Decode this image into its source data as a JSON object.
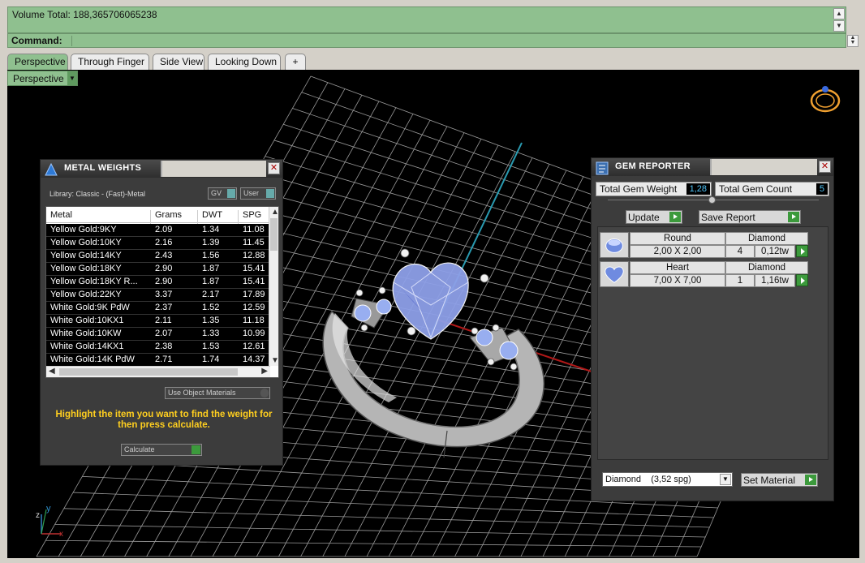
{
  "command": {
    "history_text": "Volume Total: 188,365706065238",
    "prompt_label": "Command:",
    "input_value": ""
  },
  "tabs": [
    {
      "label": "Perspective",
      "active": true
    },
    {
      "label": "Through Finger",
      "active": false
    },
    {
      "label": "Side View",
      "active": false
    },
    {
      "label": "Looking Down",
      "active": false
    },
    {
      "label": "+",
      "active": false
    }
  ],
  "viewport": {
    "selector_label": "Perspective",
    "axis_labels": {
      "x": "x",
      "y": "y",
      "z": "z"
    }
  },
  "metal_weights": {
    "title": "METAL WEIGHTS",
    "library_label": "Library: Classic - (Fast)-Metal",
    "unit_selector": "GV",
    "user_selector": "User",
    "columns": [
      "Metal",
      "Grams",
      "DWT",
      "SPG"
    ],
    "rows": [
      {
        "metal": "Yellow Gold:9KY",
        "grams": "2.09",
        "dwt": "1.34",
        "spg": "11.08"
      },
      {
        "metal": "Yellow Gold:10KY",
        "grams": "2.16",
        "dwt": "1.39",
        "spg": "11.45"
      },
      {
        "metal": "Yellow Gold:14KY",
        "grams": "2.43",
        "dwt": "1.56",
        "spg": "12.88"
      },
      {
        "metal": "Yellow Gold:18KY",
        "grams": "2.90",
        "dwt": "1.87",
        "spg": "15.41"
      },
      {
        "metal": "Yellow Gold:18KY R...",
        "grams": "2.90",
        "dwt": "1.87",
        "spg": "15.41"
      },
      {
        "metal": "Yellow Gold:22KY",
        "grams": "3.37",
        "dwt": "2.17",
        "spg": "17.89"
      },
      {
        "metal": "White Gold:9K PdW",
        "grams": "2.37",
        "dwt": "1.52",
        "spg": "12.59"
      },
      {
        "metal": "White Gold:10KX1",
        "grams": "2.11",
        "dwt": "1.35",
        "spg": "11.18"
      },
      {
        "metal": "White Gold:10KW",
        "grams": "2.07",
        "dwt": "1.33",
        "spg": "10.99"
      },
      {
        "metal": "White Gold:14KX1",
        "grams": "2.38",
        "dwt": "1.53",
        "spg": "12.61"
      },
      {
        "metal": "White Gold:14K PdW",
        "grams": "2.71",
        "dwt": "1.74",
        "spg": "14.37"
      }
    ],
    "use_object_materials_label": "Use Object Materials",
    "hint_text": "Highlight the item you want to find the weight for then press calculate.",
    "calculate_label": "Calculate"
  },
  "gem_reporter": {
    "title": "GEM REPORTER",
    "total_weight_label": "Total Gem Weight",
    "total_weight_value": "1,28",
    "total_count_label": "Total Gem Count",
    "total_count_value": "5",
    "update_label": "Update",
    "save_report_label": "Save Report",
    "gems": [
      {
        "shape": "Round",
        "material": "Diamond",
        "size": "2,00 X 2,00",
        "count": "4",
        "weight": "0,12tw"
      },
      {
        "shape": "Heart",
        "material": "Diamond",
        "size": "7,00 X 7,00",
        "count": "1",
        "weight": "1,16tw"
      }
    ],
    "material_select": "Diamond    (3,52 spg)",
    "set_material_label": "Set Material"
  }
}
